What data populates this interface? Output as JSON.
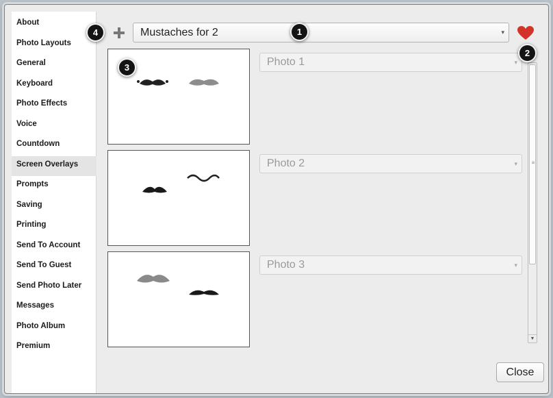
{
  "sidebar": {
    "items": [
      {
        "label": "About"
      },
      {
        "label": "Photo Layouts"
      },
      {
        "label": "General"
      },
      {
        "label": "Keyboard"
      },
      {
        "label": "Photo Effects"
      },
      {
        "label": "Voice"
      },
      {
        "label": "Countdown"
      },
      {
        "label": "Screen Overlays"
      },
      {
        "label": "Prompts"
      },
      {
        "label": "Saving"
      },
      {
        "label": "Printing"
      },
      {
        "label": "Send To Account"
      },
      {
        "label": "Send To Guest"
      },
      {
        "label": "Send Photo Later"
      },
      {
        "label": "Messages"
      },
      {
        "label": "Photo Album"
      },
      {
        "label": "Premium"
      }
    ],
    "active": "Screen Overlays"
  },
  "toolbar": {
    "layout_selected": "Mustaches for 2",
    "plus_icon": "plus-icon",
    "favorite_icon": "heart-icon",
    "favorite_color": "#d3342a"
  },
  "photos": [
    {
      "label": "Photo 1"
    },
    {
      "label": "Photo 2"
    },
    {
      "label": "Photo 3"
    }
  ],
  "badges": {
    "b1": "1",
    "b2": "2",
    "b3": "3",
    "b4": "4"
  },
  "footer": {
    "close_label": "Close"
  }
}
